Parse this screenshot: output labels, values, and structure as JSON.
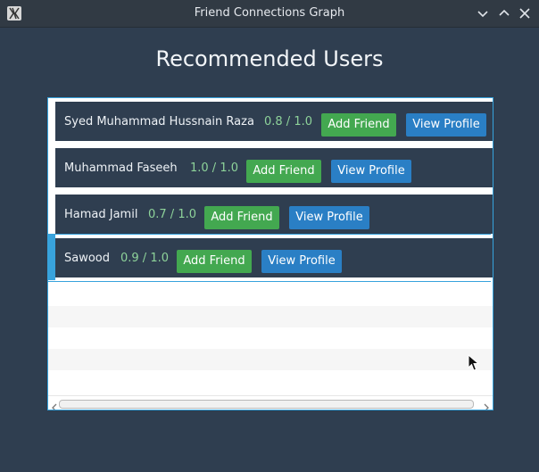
{
  "window": {
    "title": "Friend Connections Graph"
  },
  "page": {
    "heading": "Recommended Users"
  },
  "users": [
    {
      "name": "Syed Muhammad Hussnain Raza",
      "score": "0.8 / 1.0",
      "add_label": "Add Friend",
      "view_label": "View Profile"
    },
    {
      "name": "Muhammad Faseeh",
      "score": "1.0 / 1.0",
      "add_label": "Add Friend",
      "view_label": "View Profile"
    },
    {
      "name": "Hamad Jamil",
      "score": "0.7 / 1.0",
      "add_label": "Add Friend",
      "view_label": "View Profile"
    },
    {
      "name": "Sawood",
      "score": "0.9 / 1.0",
      "add_label": "Add Friend",
      "view_label": "View Profile"
    }
  ],
  "icons": {
    "app": "x-app-icon",
    "minimize": "chevron-down-icon",
    "maximize": "chevron-up-icon",
    "close": "close-icon",
    "scroll_left": "arrow-left-icon",
    "scroll_right": "arrow-right-icon"
  },
  "colors": {
    "background": "#2f3e50",
    "accent": "#38a3dd",
    "add_button": "#43a850",
    "view_button": "#2a7fc5",
    "score": "#8ed39a"
  }
}
